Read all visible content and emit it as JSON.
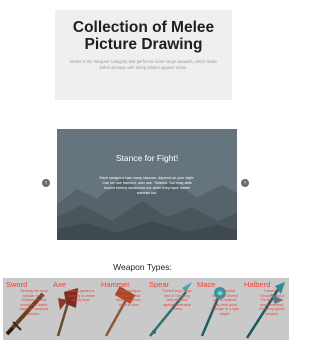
{
  "hero": {
    "title": "Collection of Melee Picture Drawing",
    "description": "Melee is the Weapon Category that performs close range assaults, which make lethal damage with sharp blades against victim."
  },
  "slider": {
    "title": "Stance for Fight!",
    "text": "Each weapons has many stances, depend on your style. Can be use harmed, own use. Twisted. You may able exploit enemy weakness too while they have melee stances out.",
    "prev_icon": "chevron-left-icon",
    "next_icon": "chevron-right-icon"
  },
  "weapons": {
    "heading": "Weapon Types:",
    "items": [
      {
        "name": "Sword",
        "description": "Bearing the most popular melee weapon, deadly versatile in battle, balance, weapons sudden.",
        "icon": "sword-icon"
      },
      {
        "name": "Axe",
        "description": "Blades gained a cleaving to create heavy blow.",
        "icon": "axe-icon"
      },
      {
        "name": "Hammer",
        "description": "Heavy weapon that can break enemy defense, but it is slow.",
        "icon": "hammer-icon"
      },
      {
        "name": "Spear",
        "description": "Famed long range fast of Thrusting very effective against defensive enemy.",
        "icon": "spear-icon"
      },
      {
        "name": "Mace",
        "description": "Dual combat weapon. Enemy can be bashed, they deal good damage to a light knight.",
        "icon": "mace-icon"
      },
      {
        "name": "Halberd",
        "description": "Famed to Thrusting fast & Thrusting also, reach enemies. Fine long glaive weapon.",
        "icon": "halberd-icon"
      }
    ]
  },
  "colors": {
    "card_text": "#e8453c",
    "card_bg": "#c9c9c9",
    "slider_bg": "#5e6c73"
  }
}
